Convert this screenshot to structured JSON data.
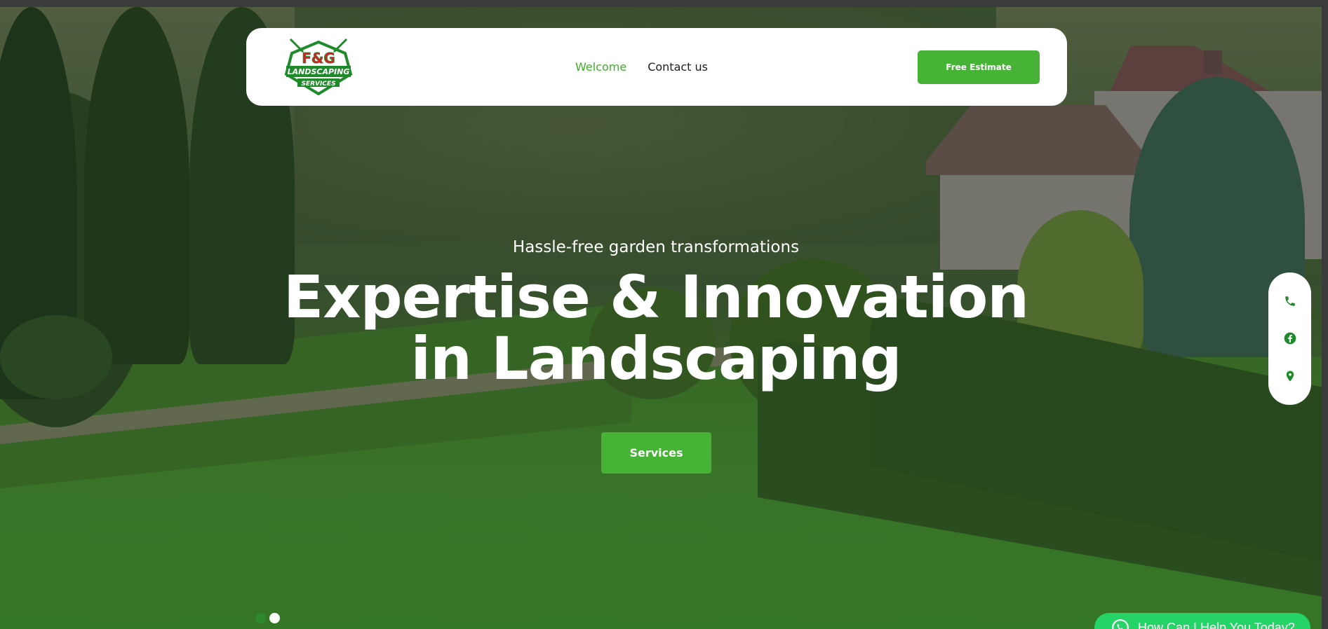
{
  "colors": {
    "accent_green": "#46b337",
    "nav_active": "#3fae2a",
    "icon_green": "#1f8a2a",
    "whatsapp_green": "#25d366"
  },
  "logo": {
    "line1": "F&G",
    "line2": "LANDSCAPING",
    "line3": "SERVICES"
  },
  "nav": {
    "items": [
      {
        "label": "Welcome",
        "active": true
      },
      {
        "label": "Contact us",
        "active": false
      }
    ],
    "cta_label": "Free Estimate"
  },
  "hero": {
    "subtitle": "Hassle-free garden transformations",
    "headline_line1": "Expertise & Innovation",
    "headline_line2": "in Landscaping",
    "button_label": "Services"
  },
  "slider": {
    "count": 2,
    "active_index": 0
  },
  "side_contacts": [
    {
      "icon": "phone-icon"
    },
    {
      "icon": "facebook-icon"
    },
    {
      "icon": "location-pin-icon"
    }
  ],
  "whatsapp": {
    "label": "How Can I Help You Today?",
    "icon": "whatsapp-icon"
  }
}
